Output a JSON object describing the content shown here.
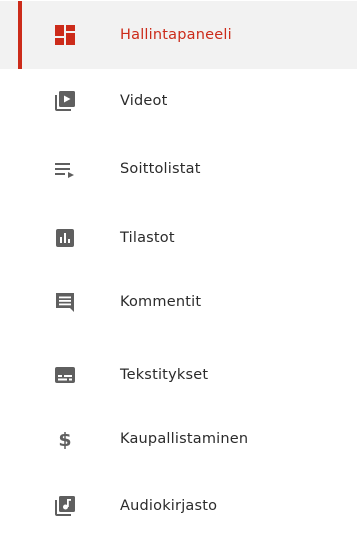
{
  "sidebar": {
    "items": [
      {
        "label": "Hallintapaneeli",
        "icon": "dashboard-icon",
        "active": true
      },
      {
        "label": "Videot",
        "icon": "video-library-icon",
        "active": false
      },
      {
        "label": "Soittolistat",
        "icon": "playlist-icon",
        "active": false
      },
      {
        "label": "Tilastot",
        "icon": "analytics-icon",
        "active": false
      },
      {
        "label": "Kommentit",
        "icon": "comment-icon",
        "active": false
      },
      {
        "label": "Tekstitykset",
        "icon": "subtitles-icon",
        "active": false
      },
      {
        "label": "Kaupallistaminen",
        "icon": "dollar-icon",
        "active": false
      },
      {
        "label": "Audiokirjasto",
        "icon": "audio-library-icon",
        "active": false
      }
    ]
  },
  "colors": {
    "accent": "#cc2b1a",
    "icon": "#5f5f5f",
    "text": "#2b2b2b",
    "active_background": "#f2f2f2"
  }
}
